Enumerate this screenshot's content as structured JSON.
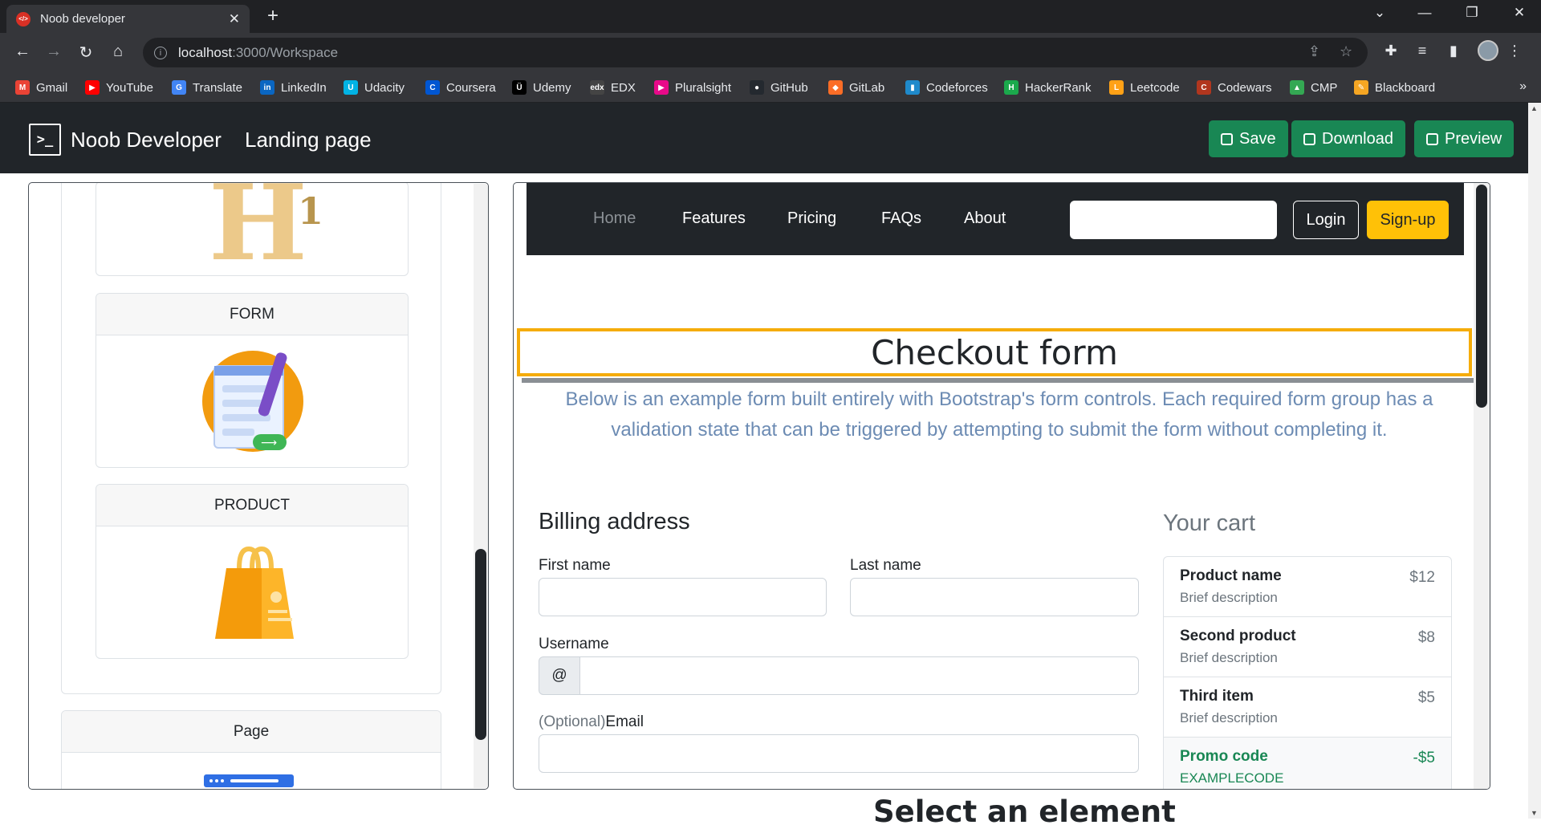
{
  "browser": {
    "tab_title": "Noob developer",
    "tab_favicon": "</>",
    "url_host": "localhost",
    "url_path": ":3000/Workspace",
    "bookmarks": [
      {
        "label": "Gmail",
        "color": "#ea4335",
        "glyph": "M"
      },
      {
        "label": "YouTube",
        "color": "#ff0000",
        "glyph": "▶"
      },
      {
        "label": "Translate",
        "color": "#4285f4",
        "glyph": "G"
      },
      {
        "label": "LinkedIn",
        "color": "#0a66c2",
        "glyph": "in"
      },
      {
        "label": "Udacity",
        "color": "#02b3e4",
        "glyph": "U"
      },
      {
        "label": "Coursera",
        "color": "#0056d2",
        "glyph": "C"
      },
      {
        "label": "Udemy",
        "color": "#000000",
        "glyph": "Ü"
      },
      {
        "label": "EDX",
        "color": "#444444",
        "glyph": "edx"
      },
      {
        "label": "Pluralsight",
        "color": "#e80a89",
        "glyph": "▶"
      },
      {
        "label": "GitHub",
        "color": "#24292f",
        "glyph": "●"
      },
      {
        "label": "GitLab",
        "color": "#fc6d26",
        "glyph": "◆"
      },
      {
        "label": "Codeforces",
        "color": "#1f8acb",
        "glyph": "▮"
      },
      {
        "label": "HackerRank",
        "color": "#1ba94c",
        "glyph": "H"
      },
      {
        "label": "Leetcode",
        "color": "#ffa116",
        "glyph": "L"
      },
      {
        "label": "Codewars",
        "color": "#b1361e",
        "glyph": "C"
      },
      {
        "label": "CMP",
        "color": "#34a853",
        "glyph": "▲"
      },
      {
        "label": "Blackboard",
        "color": "#f5a623",
        "glyph": "✎"
      }
    ]
  },
  "app": {
    "brand": "Noob Developer",
    "logo_glyph": ">_",
    "page_name": "Landing page",
    "buttons": {
      "save": "Save",
      "download": "Download",
      "preview": "Preview"
    }
  },
  "sidebar": {
    "cards": [
      {
        "title": "FORM",
        "icon": "form-icon"
      },
      {
        "title": "PRODUCT",
        "icon": "shopping-bag-icon"
      }
    ],
    "page_card": {
      "title": "Page"
    }
  },
  "preview": {
    "nav": {
      "items": [
        "Home",
        "Features",
        "Pricing",
        "FAQs",
        "About"
      ],
      "login": "Login",
      "signup": "Sign-up"
    },
    "heading": "Checkout form",
    "lead": "Below is an example form built entirely with Bootstrap's form controls. Each required form group has a validation state that can be triggered by attempting to submit the form without completing it.",
    "billing": {
      "title": "Billing address",
      "first_name": "First name",
      "last_name": "Last name",
      "username": "Username",
      "at": "@",
      "email_optional": "(Optional)",
      "email": "Email"
    },
    "cart": {
      "title": "Your cart",
      "items": [
        {
          "name": "Product name",
          "desc": "Brief description",
          "price": "$12"
        },
        {
          "name": "Second product",
          "desc": "Brief description",
          "price": "$8"
        },
        {
          "name": "Third item",
          "desc": "Brief description",
          "price": "$5"
        },
        {
          "name": "Promo code",
          "desc": "EXAMPLECODE",
          "price": "-$5"
        }
      ]
    }
  },
  "below_text": "Select an element",
  "colors": {
    "success": "#198754",
    "warning": "#ffc107",
    "selection": "#f5ac0a",
    "dark": "#212529"
  }
}
